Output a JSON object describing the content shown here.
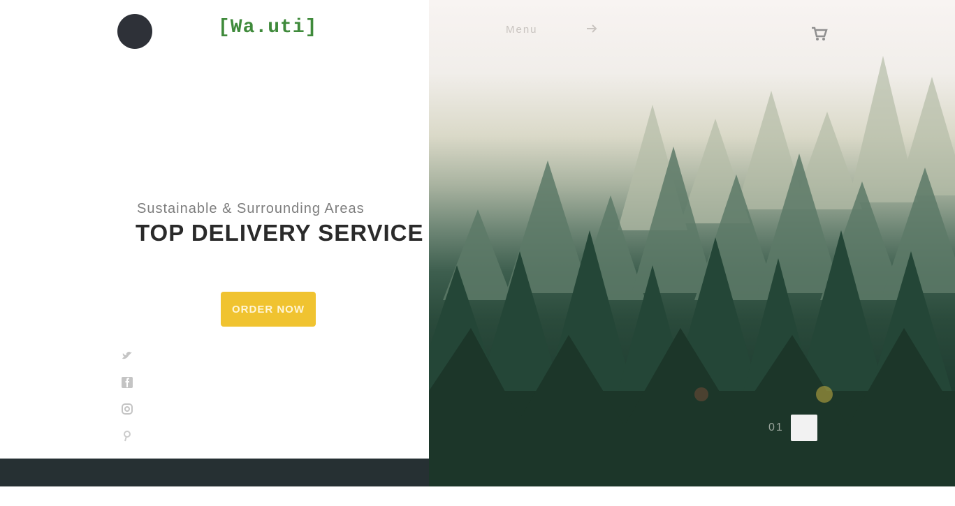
{
  "brand": {
    "logo_text": "[Wa.uti]"
  },
  "nav": {
    "link_label": "Menu",
    "arrow_icon": "arrow-right-icon",
    "cart_icon": "cart-icon"
  },
  "hero": {
    "subtitle": "Sustainable & Surrounding Areas",
    "headline": "TOP DELIVERY SERVICE",
    "cta_label": "ORDER NOW"
  },
  "social": {
    "icons": [
      "twitter-icon",
      "facebook-icon",
      "instagram-icon",
      "pinterest-icon"
    ]
  },
  "slider": {
    "current": "01"
  },
  "colors": {
    "accent": "#f0c330",
    "brand_green": "#3f8a3b",
    "dark": "#263033"
  }
}
